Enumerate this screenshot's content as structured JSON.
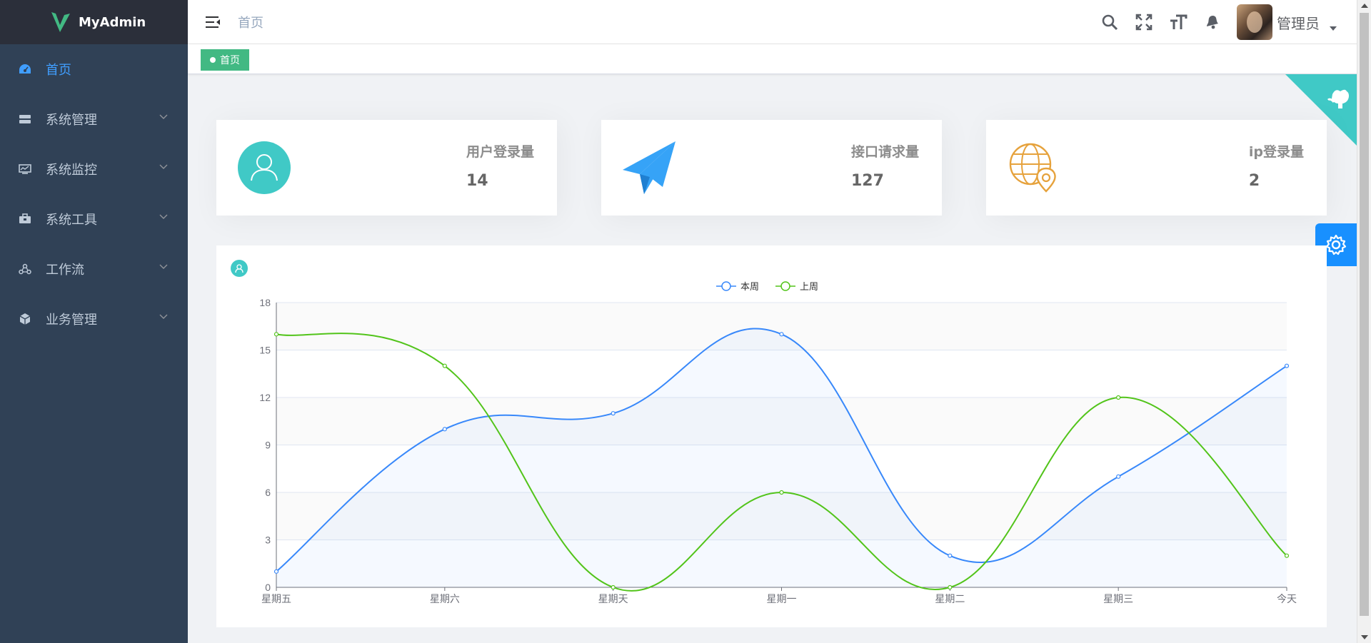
{
  "app": {
    "title": "MyAdmin"
  },
  "sidebar": {
    "items": [
      {
        "label": "首页",
        "icon": "dashboard-icon",
        "active": true,
        "expandable": false
      },
      {
        "label": "系统管理",
        "icon": "system-icon",
        "expandable": true
      },
      {
        "label": "系统监控",
        "icon": "monitor-icon",
        "expandable": true
      },
      {
        "label": "系统工具",
        "icon": "toolbox-icon",
        "expandable": true
      },
      {
        "label": "工作流",
        "icon": "workflow-icon",
        "expandable": true
      },
      {
        "label": "业务管理",
        "icon": "business-icon",
        "expandable": true
      }
    ]
  },
  "navbar": {
    "breadcrumb": "首页",
    "username": "管理员",
    "icons": [
      "search-icon",
      "fullscreen-icon",
      "font-size-icon",
      "bell-icon"
    ]
  },
  "tags": [
    {
      "label": "首页",
      "active": true
    }
  ],
  "panels": [
    {
      "label": "用户登录量",
      "value": "14",
      "icon": "user-icon",
      "color": "#40c9c6"
    },
    {
      "label": "接口请求量",
      "value": "127",
      "icon": "paper-plane-icon",
      "color": "#36a3f7"
    },
    {
      "label": "ip登录量",
      "value": "2",
      "icon": "globe-location-icon",
      "color": "#e6a23c"
    }
  ],
  "chart_data": {
    "type": "line",
    "categories": [
      "星期五",
      "星期六",
      "星期天",
      "星期一",
      "星期二",
      "星期三",
      "今天"
    ],
    "series": [
      {
        "name": "本周",
        "values": [
          1,
          10,
          11,
          16,
          2,
          7,
          14
        ],
        "color": "#3888fa",
        "area": true
      },
      {
        "name": "上周",
        "values": [
          16,
          14,
          0,
          6,
          0,
          12,
          2
        ],
        "color": "#52c41a"
      }
    ],
    "ylim": [
      0,
      18
    ],
    "yticks": [
      0,
      3,
      6,
      9,
      12,
      15,
      18
    ],
    "legend": "top-center",
    "grid": true
  },
  "colors": {
    "sidebar": "#304156",
    "accent": "#409eff",
    "tag": "#42b983",
    "github_corner": "#40c9c6",
    "settings": "#1890ff"
  }
}
